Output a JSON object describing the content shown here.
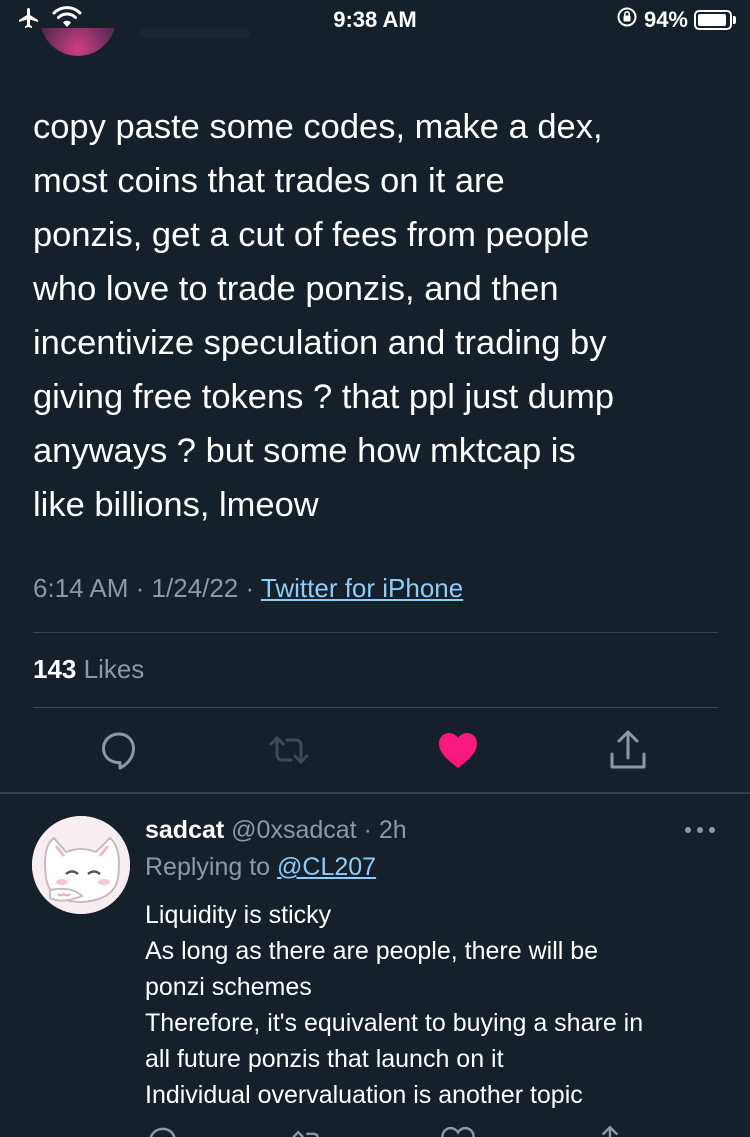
{
  "status_bar": {
    "time": "9:38 AM",
    "battery_percent": "94%",
    "battery_level": 0.94
  },
  "tweet": {
    "lines": [
      "copy paste some codes, make a dex,",
      "most coins that trades on it are",
      "ponzis, get a cut of fees from people",
      "who love to trade ponzis, and then",
      "incentivize speculation and trading by",
      "giving free tokens ? that ppl just dump",
      "anyways ? but some how mktcap is",
      "like billions, lmeow"
    ],
    "time": "6:14 AM",
    "sep1": " · ",
    "date": "1/24/22",
    "sep2": " · ",
    "source": "Twitter for iPhone",
    "likes_count": "143",
    "likes_label": " Likes"
  },
  "actions": {
    "reply": "reply-icon",
    "retweet": "retweet-icon",
    "like": "heart-filled-icon",
    "share": "share-icon",
    "like_color": "#f91880"
  },
  "reply": {
    "name": "sadcat",
    "handle": " @0xsadcat · 2h",
    "replying_prefix": "Replying to ",
    "replying_to": "@CL207",
    "lines": [
      "Liquidity is sticky",
      "As long as there are people, there will be",
      "ponzi schemes",
      "Therefore, it's equivalent to buying a share in",
      "all future ponzis that launch on it",
      "Individual overvaluation is another topic"
    ]
  },
  "colors": {
    "background": "#15202b",
    "secondary_text": "#8b98a5",
    "link": "#8ecdf8",
    "divider": "#38444d"
  }
}
